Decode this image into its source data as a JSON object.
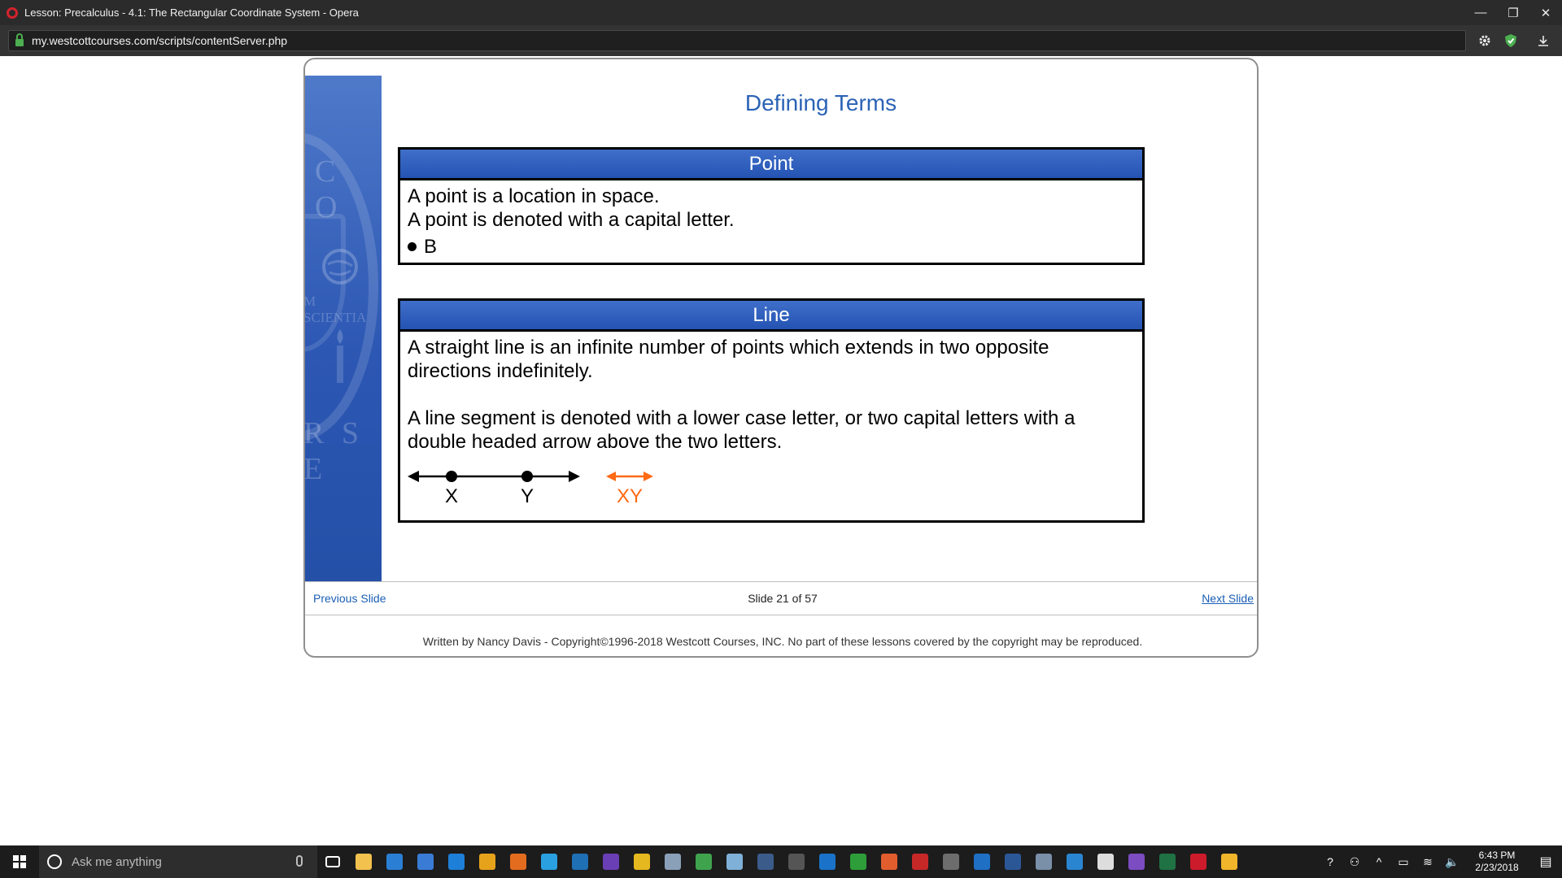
{
  "window": {
    "title": "Lesson: Precalculus - 4.1: The Rectangular Coordinate System - Opera",
    "minimize": "—",
    "restore": "❐",
    "close": "✕"
  },
  "address_bar": {
    "url": "my.westcottcourses.com/scripts/contentServer.php"
  },
  "sidebar": {
    "seal_letters_top": "C O",
    "seal_motto": "M SCIENTIA",
    "seal_letters_bottom": "R S E"
  },
  "slide": {
    "title": "Defining Terms",
    "point_card": {
      "heading": "Point",
      "line1": "A point is a location in space.",
      "line2": "A point is denoted with a capital letter.",
      "example_label": "B"
    },
    "line_card": {
      "heading": "Line",
      "para1": "A straight line is an infinite number of points which extends in two opposite directions indefinitely.",
      "para2": "A line segment is denoted with a lower case letter, or two capital letters with a double headed arrow above the two letters.",
      "label_x": "X",
      "label_y": "Y",
      "label_xy": "XY",
      "arrow_color": "#ff6a13"
    }
  },
  "nav": {
    "previous": "Previous Slide",
    "slide_counter": "Slide 21 of 57",
    "next": "Next Slide"
  },
  "footer": {
    "copyright": "Written by Nancy Davis - Copyright©1996-2018 Westcott Courses, INC. No part of these lessons covered by the copyright may be reproduced."
  },
  "taskbar": {
    "search_placeholder": "Ask me anything",
    "apps": [
      {
        "name": "task-view-icon",
        "color": "#1c1c1c"
      },
      {
        "name": "file-explorer-icon",
        "color": "#f2c14e"
      },
      {
        "name": "store-icon",
        "color": "#2a7fd4"
      },
      {
        "name": "xmind-icon",
        "color": "#3a7bd5"
      },
      {
        "name": "edge-icon",
        "color": "#1e7fd8"
      },
      {
        "name": "chrome-icon",
        "color": "#e7a21b"
      },
      {
        "name": "firefox-icon",
        "color": "#e46c1e"
      },
      {
        "name": "edge-beta-icon",
        "color": "#2aa0e0"
      },
      {
        "name": "powershell-icon",
        "color": "#1f6fb5"
      },
      {
        "name": "dp-icon",
        "color": "#6a3fb5"
      },
      {
        "name": "star-app-icon",
        "color": "#e6b820"
      },
      {
        "name": "paint-icon",
        "color": "#8aa0b8"
      },
      {
        "name": "lambda-icon",
        "color": "#3fa34d"
      },
      {
        "name": "notes-icon",
        "color": "#7fb0d8"
      },
      {
        "name": "kindle-icon",
        "color": "#3b5b8a"
      },
      {
        "name": "calculator-icon",
        "color": "#555555"
      },
      {
        "name": "teamviewer-icon",
        "color": "#1a73c9"
      },
      {
        "name": "camtasia-icon",
        "color": "#2e9e3a"
      },
      {
        "name": "puzzle-app-icon",
        "color": "#e25d2e"
      },
      {
        "name": "filezilla-icon",
        "color": "#c62828"
      },
      {
        "name": "sublime-icon",
        "color": "#6d6d6d"
      },
      {
        "name": "outlook-icon",
        "color": "#1f6fc4"
      },
      {
        "name": "word-icon",
        "color": "#2b5797"
      },
      {
        "name": "network-app-icon",
        "color": "#7a8fa8"
      },
      {
        "name": "remote-desktop-icon",
        "color": "#2a85d0"
      },
      {
        "name": "mail-icon",
        "color": "#dddddd"
      },
      {
        "name": "visual-studio-icon",
        "color": "#7b4cc2"
      },
      {
        "name": "excel-icon",
        "color": "#1f7244"
      },
      {
        "name": "opera-icon",
        "color": "#cc1b2b"
      },
      {
        "name": "presentation-icon",
        "color": "#f0b52a"
      }
    ],
    "tray": {
      "help": "?",
      "people": "⚇",
      "chevron": "^",
      "battery": "▭",
      "wifi": "≋",
      "volume": "🔈",
      "time": "6:43 PM",
      "date": "2/23/2018",
      "notification": "▤"
    }
  }
}
